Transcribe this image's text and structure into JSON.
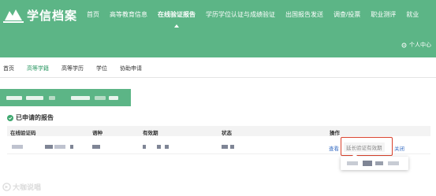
{
  "header": {
    "logo_text": "学信档案",
    "nav": [
      {
        "label": "首页",
        "active": false
      },
      {
        "label": "高等教育信息",
        "active": false
      },
      {
        "label": "在线验证报告",
        "active": true
      },
      {
        "label": "学历学位认证与成绩验证",
        "active": false
      },
      {
        "label": "出国报告发送",
        "active": false
      },
      {
        "label": "调查/投票",
        "active": false
      },
      {
        "label": "职业测评",
        "active": false
      },
      {
        "label": "就业",
        "active": false
      }
    ],
    "user_center": "个人中心"
  },
  "subnav": [
    {
      "label": "首页",
      "active": false
    },
    {
      "label": "高等学籍",
      "active": true
    },
    {
      "label": "高等学历",
      "active": false
    },
    {
      "label": "学位",
      "active": false
    },
    {
      "label": "协助申请",
      "active": false
    }
  ],
  "section": {
    "title": "已申请的报告"
  },
  "table": {
    "columns": [
      "在线验证码",
      "语种",
      "有效期",
      "状态",
      "操作"
    ]
  },
  "row": {
    "view": "查看",
    "extend": "延长验证有效期",
    "close": "关闭"
  },
  "watermark": "大咖说唱",
  "colors": {
    "brand_green": "#5cb586",
    "active_text": "#2f9a66",
    "link_blue": "#3a6fc4",
    "highlight_red": "#d8402b"
  }
}
